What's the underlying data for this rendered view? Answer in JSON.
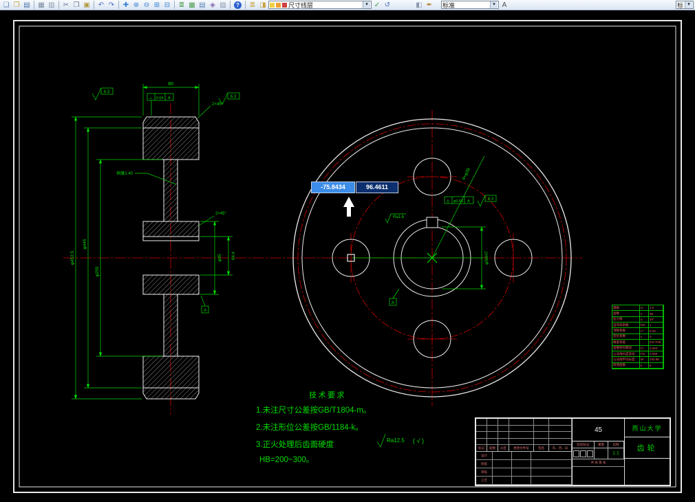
{
  "toolbar": {
    "items": [
      {
        "t": "icon",
        "n": "new-file",
        "g": "❏",
        "c": "#5a82b4"
      },
      {
        "t": "icon",
        "n": "open-file",
        "g": "❐",
        "c": "#caa23c"
      },
      {
        "t": "icon",
        "n": "save-file",
        "g": "▤",
        "c": "#4a72a4"
      },
      {
        "t": "sep"
      },
      {
        "t": "icon",
        "n": "plot",
        "g": "▦",
        "c": "#7a8aa0"
      },
      {
        "t": "icon",
        "n": "plot-preview",
        "g": "▥",
        "c": "#8a98ac"
      },
      {
        "t": "sep"
      },
      {
        "t": "icon",
        "n": "cut",
        "g": "✂",
        "c": "#6a7a92"
      },
      {
        "t": "icon",
        "n": "copy",
        "g": "❒",
        "c": "#6a7a92"
      },
      {
        "t": "icon",
        "n": "paste",
        "g": "▣",
        "c": "#b09a40"
      },
      {
        "t": "sep"
      },
      {
        "t": "icon",
        "n": "undo",
        "g": "↶",
        "c": "#4a6ac0"
      },
      {
        "t": "icon",
        "n": "redo",
        "g": "↷",
        "c": "#4a6ac0"
      },
      {
        "t": "sep"
      },
      {
        "t": "icon",
        "n": "pan",
        "g": "✚",
        "c": "#3a84d0"
      },
      {
        "t": "icon",
        "n": "zoom-in",
        "g": "⊕",
        "c": "#3a84d0"
      },
      {
        "t": "icon",
        "n": "zoom-out",
        "g": "⊖",
        "c": "#3a84d0"
      },
      {
        "t": "icon",
        "n": "zoom-window",
        "g": "⊞",
        "c": "#3a84d0"
      },
      {
        "t": "icon",
        "n": "zoom-previous",
        "g": "⊟",
        "c": "#3a84d0"
      },
      {
        "t": "sep"
      },
      {
        "t": "icon",
        "n": "layer-grid",
        "g": "≣",
        "c": "#4a9a4a"
      },
      {
        "t": "icon",
        "n": "table",
        "g": "▦",
        "c": "#4a9a4a"
      },
      {
        "t": "icon",
        "n": "sheet-set",
        "g": "▤",
        "c": "#5a82b4"
      },
      {
        "t": "icon",
        "n": "block",
        "g": "◈",
        "c": "#8a6ab0"
      },
      {
        "t": "icon",
        "n": "image",
        "g": "▨",
        "c": "#8a98ac"
      },
      {
        "t": "sep"
      },
      {
        "t": "icon",
        "n": "help",
        "g": "?",
        "c": "#ffffff"
      },
      {
        "t": "sep"
      },
      {
        "t": "icon",
        "n": "layer-manager",
        "g": "≣",
        "c": "#caa23c"
      },
      {
        "t": "icon",
        "n": "layer-states",
        "g": "◨",
        "c": "#caa23c"
      },
      {
        "t": "combo",
        "n": "layer",
        "w": 150,
        "value": "尺寸线层",
        "swatches": [
          "#f0d040",
          "#f0a030",
          "#d04040"
        ]
      },
      {
        "t": "icon",
        "n": "make-current",
        "g": "✓",
        "c": "#3a9a3a"
      },
      {
        "t": "icon",
        "n": "layer-previous",
        "g": "↺",
        "c": "#4a6ac0"
      },
      {
        "t": "gap",
        "w": 30
      },
      {
        "t": "icon",
        "n": "properties-palette",
        "g": "◧",
        "c": "#8a98ac"
      },
      {
        "t": "icon",
        "n": "match-properties",
        "g": "✒",
        "c": "#b08030"
      },
      {
        "t": "gap",
        "w": 8
      },
      {
        "t": "combo",
        "n": "style",
        "w": 84,
        "value": "标准"
      },
      {
        "t": "icon",
        "n": "text-style",
        "g": "A",
        "c": "#4a4a4a"
      },
      {
        "t": "combo",
        "n": "dim-style",
        "w": 26,
        "value": "标准",
        "push": true
      }
    ]
  },
  "tooltip": {
    "x_value": "-75.8434",
    "y_value": "96.4611"
  },
  "dims": {
    "top_width": "80",
    "chamfer_top": "2×45°",
    "dia_outer": "φ452.5",
    "dia_root": "φ445",
    "dia_web": "φ255",
    "hub_dia": "φ95",
    "keyway_h": "64.4",
    "taper": "斜度1:40",
    "hub_chamfer": "2×45°",
    "holes": "4×φ39",
    "bore": "φ58H7",
    "datum": "A",
    "tol_left": {
      "sym": "⊥",
      "val": "0.04",
      "ref": "A"
    },
    "tol_front": {
      "sym": "◎",
      "val": "φ0.05",
      "ref": "A"
    },
    "rough_a": "6.3",
    "rough_b": "6.3",
    "rough_front": "6.3",
    "rough_c": "Ra1.6",
    "rough_note": "Ra12.5",
    "rough_note2": "( √ )"
  },
  "tech_req": {
    "title": "技术要求",
    "lines": [
      "1.未注尺寸公差按GB/T1804-m。",
      "2.未注形位公差按GB/1184-k。",
      "3.正火处理后齿面硬度",
      "HB=200~300。"
    ]
  },
  "param_table": {
    "rows": [
      [
        "模数",
        "m",
        "4.5"
      ],
      [
        "齿数",
        "z",
        "98"
      ],
      [
        "压力角",
        "α",
        "20°"
      ],
      [
        "齿顶高系数",
        "ha*",
        "1"
      ],
      [
        "顶隙系数",
        "c*",
        "0.25"
      ],
      [
        "变位系数",
        "x",
        "0"
      ],
      [
        "精度等级",
        "",
        "8-8-7HK"
      ],
      [
        "齿圈径向跳动",
        "Fr",
        "0.063"
      ],
      [
        "公法线长度变动",
        "Fw",
        "0.050"
      ],
      [
        "公法线平均长度",
        "W",
        "103.96"
      ],
      [
        "跨测齿数",
        "k",
        "8"
      ]
    ]
  },
  "title_block": {
    "material": "45",
    "company": "燕山大学",
    "part_name": "齿轮",
    "rev_headers": [
      "标记",
      "处数",
      "分区",
      "更改文件号",
      "签名",
      "年、月、日"
    ],
    "sign_labels": [
      "设计",
      "校核",
      "审核",
      "工艺"
    ],
    "stage_label": "阶段标记",
    "weight_label": "重量",
    "scale_label": "比例",
    "scale_value": "1:1",
    "sheet_note": "共 张 第 张"
  }
}
